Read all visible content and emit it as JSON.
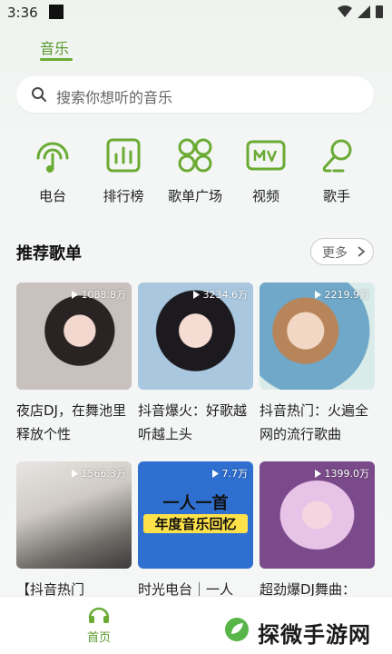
{
  "status": {
    "time": "3:36"
  },
  "top_tab": {
    "label": "音乐"
  },
  "search": {
    "placeholder": "搜索你想听的音乐"
  },
  "categories": [
    {
      "label": "电台",
      "icon": "radio-icon"
    },
    {
      "label": "排行榜",
      "icon": "chart-icon"
    },
    {
      "label": "歌单广场",
      "icon": "grid-icon"
    },
    {
      "label": "视频",
      "icon": "mv-icon"
    },
    {
      "label": "歌手",
      "icon": "singer-icon"
    }
  ],
  "section": {
    "title": "推荐歌单",
    "more_label": "更多"
  },
  "playlists": [
    {
      "title": "夜店DJ，在舞池里释放个性",
      "plays": "1088.8万"
    },
    {
      "title": "抖音爆火：好歌越听越上头",
      "plays": "3234.6万"
    },
    {
      "title": "抖音热门：火遍全网的流行歌曲",
      "plays": "2219.9万"
    },
    {
      "title": "【抖音热门",
      "plays": "1566.3万"
    },
    {
      "title": "时光电台｜一人",
      "plays": "7.7万",
      "cover_text": "一人一首",
      "cover_text2": "年度音乐回忆"
    },
    {
      "title": "超劲爆DJ舞曲：",
      "plays": "1399.0万"
    }
  ],
  "nav": {
    "home_label": "首页"
  },
  "watermark": {
    "text": "探微手游网"
  },
  "colors": {
    "accent": "#6aab34",
    "accent_dark": "#5a9a2c"
  }
}
